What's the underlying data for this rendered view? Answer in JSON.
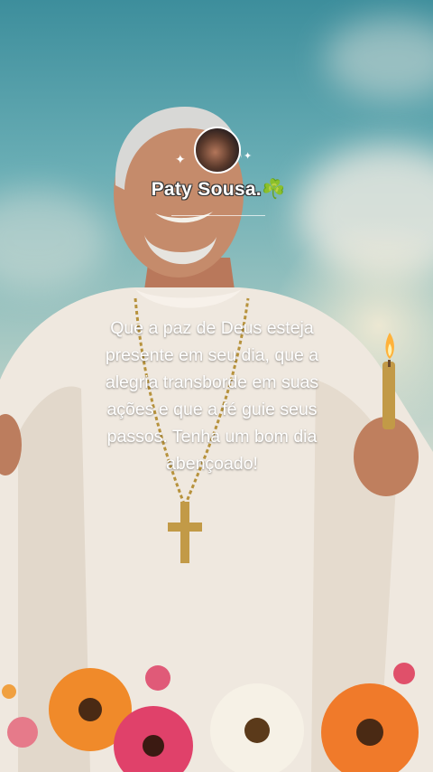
{
  "profile": {
    "username": "Paty Sousa.",
    "emoji": "☘️",
    "avatar_icon": "profile-avatar",
    "sparkle_icon": "sparkle"
  },
  "message": {
    "lines": [
      "Que a paz de Deus esteja",
      "presente em seu dia, que a",
      "alegria transborde em suas",
      "ações e que a fé guie seus",
      "passos. Tenha um bom dia",
      "abençoado!"
    ]
  },
  "colors": {
    "text": "#ffffff",
    "robe": "#efe8df",
    "sky": "#5fa6b0",
    "flower_orange": "#f08a2a",
    "flower_pink": "#e0416a"
  }
}
